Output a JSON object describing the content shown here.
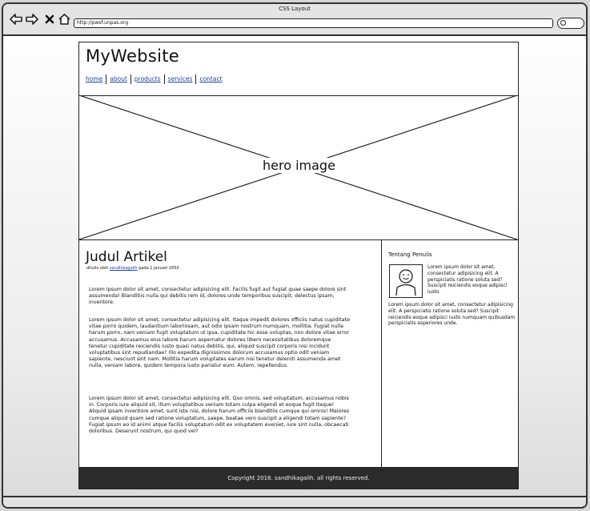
{
  "window": {
    "title": "CSS Layout",
    "url": "http://pwsf-unpas.org"
  },
  "icons": {
    "back": "back-arrow-icon",
    "forward": "forward-arrow-icon",
    "stop": "close-icon",
    "home": "home-icon",
    "search": "search-icon",
    "resize": "resize-grip-icon",
    "cursor": "mouse-pointer-icon"
  },
  "site": {
    "title": "MyWebsite",
    "menu": [
      {
        "label": "home"
      },
      {
        "label": "about"
      },
      {
        "label": "products"
      },
      {
        "label": "services"
      },
      {
        "label": "contact"
      }
    ],
    "hero_label": "hero image",
    "article": {
      "title": "Judul Artikel",
      "byline_prefix": "ditulis oleh",
      "author": "sandhikagalih",
      "byline_suffix": "pada 1 januari 2050",
      "paragraphs": [
        "Lorem ipsum dolor sit amet, consectetur adipisicing elit. Facilis fugit aut fugiat quae saepe dolore sint assumenda! Blanditiis nulla qui debitis rem id, dolores unde temporibus suscipit, delectus ipsam, inventore.",
        "Lorem ipsum dolor sit amet, consectetur adipisicing elit. Itaque impedit dolores officiis natus cupiditate vitae porro quidem, laudantium laboriosam, aut odio ipsam nostrum numquam, mollitia. Fugiat nulla harum porro, nam veniam fugit voluptatum ut ipsa, cupiditate hic esse voluptas, non dolore vitae error accusamus. Accusamus eius labore harum aspernatur dolores libero necessitatibus doloremque tenetur cupiditate reiciendis iusto quasi natus debitis, qui, aliquid suscipit corporis nisi incidunt voluptatibus sint repudiandae? Illo expedita dignissimos dolorum accusamus optio odit veniam sapiente, nesciunt sint nam. Mollitia harum voluptates earum nisi tenetur deleniti assumenda amet nulla, veniam labore, quidem tempora iusto pariatur eum. Autem, repellendus.",
        "Lorem ipsum dolor sit amet, consectetur adipisicing elit. Quo omnis, sed voluptatum, accusamus nobis in. Corporis iure aliquid sit, illum voluptatibus veniam totam culpa eligendi et eoque fugit itaque! Aliquid ipsam inventore amet, sunt iste nisi, dolore harum officiis blanditiis cumque qui omnis! Maiores cumque aliquid quam sed ratione voluptatum, saepe, beatae vero suscipit a eligendi totam sapiente? Fugiat ipsum eo id animi atque facilis voluptatum odit ex voluptatem eveniet, iure sint nulla, obcaecati doloribus. Deserunt nostrum, qui quod vel?"
      ]
    },
    "sidebar": {
      "title": "Tentang Penulis",
      "text_top": "Lorem ipsum dolor sit amet, consectetur adipisicing elit. A perspiciatis ratione soluta sed? Suscipit reiciendis eoque adipisci iusto",
      "text_bottom": "Lorem ipsum dolor sit amet, consectetur adipisicing elit. A perspiciatis ratione soluta sed? Suscipit reiciendis eoque adipisci iusto numquam quibusdam perspiciatis asperiores unde."
    },
    "footer": "Copyright 2016. sandhikagalih. all rights reserved."
  }
}
